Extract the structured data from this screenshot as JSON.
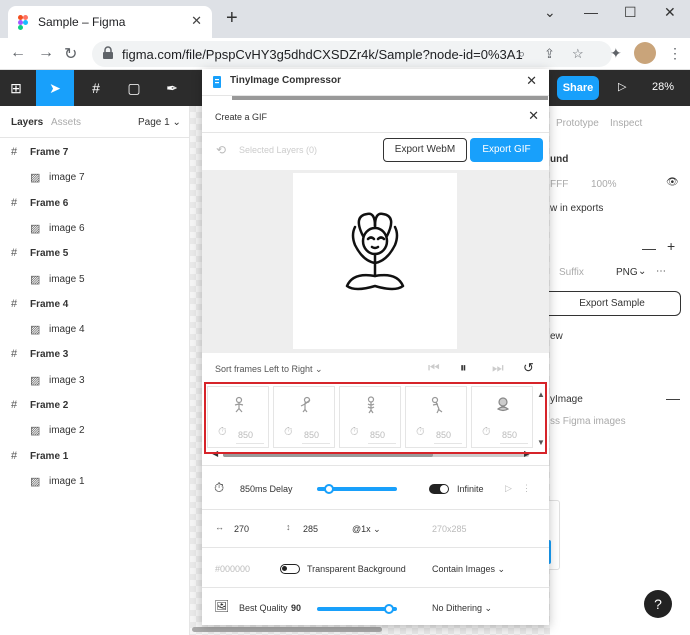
{
  "browser": {
    "tab_title": "Sample – Figma",
    "tab_close": "✕",
    "new_tab": "+",
    "url": "figma.com/file/PpspCvHY3g5dhdCXSDZr4k/Sample?node-id=0%3A1",
    "window_controls": [
      "⌄",
      "—",
      "☐",
      "✕"
    ]
  },
  "figma_toolbar": {
    "share_label": "Share",
    "zoom_label": "28%"
  },
  "left_panel": {
    "tabs": [
      "Layers",
      "Assets"
    ],
    "page_label": "Page 1 ⌄",
    "layers": [
      {
        "name": "Frame 7",
        "type": "frame"
      },
      {
        "name": "image 7",
        "type": "image"
      },
      {
        "name": "Frame 6",
        "type": "frame"
      },
      {
        "name": "image 6",
        "type": "image"
      },
      {
        "name": "Frame 5",
        "type": "frame"
      },
      {
        "name": "image 5",
        "type": "image"
      },
      {
        "name": "Frame 4",
        "type": "frame"
      },
      {
        "name": "image 4",
        "type": "image"
      },
      {
        "name": "Frame 3",
        "type": "frame"
      },
      {
        "name": "image 3",
        "type": "image"
      },
      {
        "name": "Frame 2",
        "type": "frame"
      },
      {
        "name": "image 2",
        "type": "image"
      },
      {
        "name": "Frame 1",
        "type": "frame"
      },
      {
        "name": "image 1",
        "type": "image"
      }
    ]
  },
  "right_panel": {
    "tabs": [
      "Prototype",
      "Inspect"
    ],
    "background_label": "und",
    "hex_partial": "FFF",
    "opacity": "100%",
    "show_in_exports": "w in exports",
    "suffix_placeholder": "Suffix",
    "format": "PNG",
    "export_sample": "Export Sample",
    "preview_partial": "ew",
    "plugin_label": "yImage",
    "plugin_sub": "ss Figma images",
    "help": "?"
  },
  "plugin": {
    "title": "TinyImage Compressor",
    "subtitle": "Create a GIF",
    "selected_layers": "Selected Layers (0)",
    "export_webm": "Export WebM",
    "export_gif": "Export GIF",
    "sort_label": "Sort frames Left to Right ⌄",
    "frames": [
      {
        "duration": "850"
      },
      {
        "duration": "850"
      },
      {
        "duration": "850"
      },
      {
        "duration": "850"
      },
      {
        "duration": "850"
      }
    ],
    "delay_label": "850ms Delay",
    "delay_fraction": 0.15,
    "loop_label": "Infinite",
    "width": "270",
    "height": "285",
    "scale": "@1x ⌄",
    "dimensions": "270x285",
    "color_placeholder": "#000000",
    "transparent_label": "Transparent Background",
    "contain_label": "Contain Images ⌄",
    "quality_label": "Best Quality",
    "quality_value": "90",
    "quality_fraction": 0.9,
    "dither_label": "No Dithering ⌄"
  },
  "colors": {
    "accent": "#18a0fb",
    "highlight": "#d6242a",
    "toolbar_bg": "#2c2c2c"
  }
}
